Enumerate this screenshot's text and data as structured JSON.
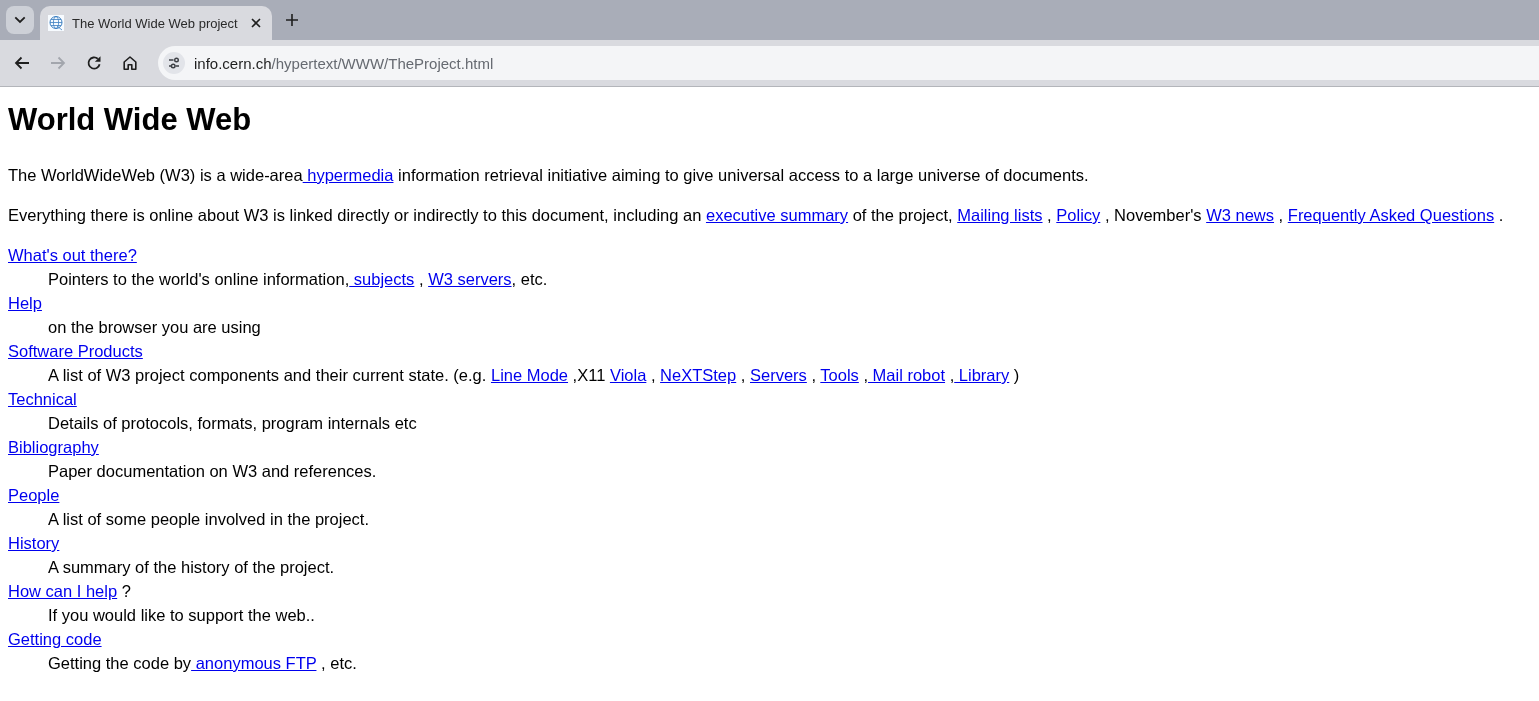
{
  "browser": {
    "tabs": [
      {
        "title": "The World Wide Web project",
        "selected": true
      }
    ],
    "nav_buttons": [
      {
        "kind": "back",
        "disabled": false
      },
      {
        "kind": "forward",
        "disabled": true
      },
      {
        "kind": "reload",
        "disabled": false
      },
      {
        "kind": "home",
        "disabled": false
      }
    ],
    "address": {
      "host": "info.cern.ch",
      "path": "/hypertext/WWW/TheProject.html"
    }
  },
  "page": {
    "heading": "World Wide Web",
    "paragraphs": [
      [
        {
          "text": "The WorldWideWeb (W3) is a wide-area",
          "link": " hypermedia"
        },
        {
          "text": " information retrieval initiative aiming to give universal access to a large universe of documents."
        }
      ],
      [
        {
          "text": "Everything there is online about W3 is linked directly or indirectly to this document, including an ",
          "link": "executive summary"
        },
        {
          "text": " of the project, ",
          "link": "Mailing lists"
        },
        {
          "text": " , ",
          "link": "Policy"
        },
        {
          "text": " , November's ",
          "link": "W3 news"
        },
        {
          "text": " , ",
          "link": "Frequently Asked Questions"
        },
        {
          "text": " ."
        }
      ]
    ],
    "entries": [
      {
        "term": [
          {
            "link": "What's out there?"
          }
        ],
        "description": [
          {
            "text": "Pointers to the world's online information,",
            "link": " subjects"
          },
          {
            "text": " , ",
            "link": "W3 servers"
          },
          {
            "text": ", etc."
          }
        ]
      },
      {
        "term": [
          {
            "link": "Help"
          }
        ],
        "description": [
          {
            "text": "on the browser you are using"
          }
        ]
      },
      {
        "term": [
          {
            "link": "Software Products"
          }
        ],
        "description": [
          {
            "text": "A list of W3 project components and their current state. (e.g. ",
            "link": "Line Mode"
          },
          {
            "text": " ,X11 ",
            "link": "Viola"
          },
          {
            "text": " , ",
            "link": "NeXTStep"
          },
          {
            "text": " , ",
            "link": "Servers"
          },
          {
            "text": " , ",
            "link": "Tools"
          },
          {
            "text": " ,",
            "link": " Mail robot"
          },
          {
            "text": " ,",
            "link": " Library"
          },
          {
            "text": " )"
          }
        ]
      },
      {
        "term": [
          {
            "link": "Technical"
          }
        ],
        "description": [
          {
            "text": "Details of protocols, formats, program internals etc"
          }
        ]
      },
      {
        "term": [
          {
            "link": "Bibliography"
          }
        ],
        "description": [
          {
            "text": "Paper documentation on W3 and references."
          }
        ]
      },
      {
        "term": [
          {
            "link": "People"
          }
        ],
        "description": [
          {
            "text": "A list of some people involved in the project."
          }
        ]
      },
      {
        "term": [
          {
            "link": "History"
          }
        ],
        "description": [
          {
            "text": "A summary of the history of the project."
          }
        ]
      },
      {
        "term": [
          {
            "link": "How can I help"
          },
          {
            "text": " ?"
          }
        ],
        "description": [
          {
            "text": "If you would like to support the web.."
          }
        ]
      },
      {
        "term": [
          {
            "link": "Getting code"
          }
        ],
        "description": [
          {
            "text": "Getting the code by",
            "link": " anonymous FTP"
          },
          {
            "text": " , etc."
          }
        ]
      }
    ]
  }
}
